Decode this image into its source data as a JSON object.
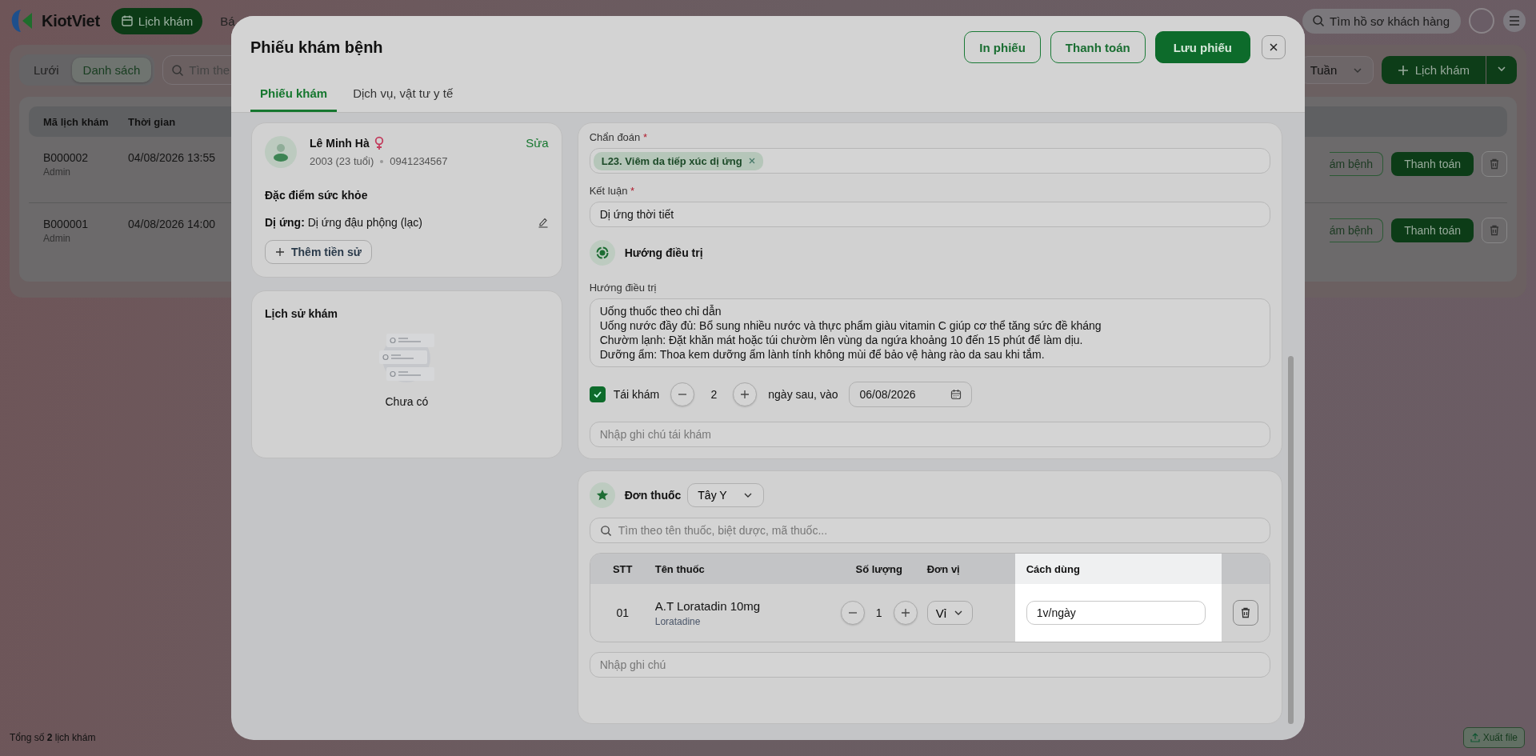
{
  "app": {
    "logo": "KiotViet",
    "nav": [
      {
        "label": "Lịch khám",
        "selected": true
      },
      {
        "label": "Bá",
        "selected": false
      }
    ],
    "search_placeholder": "Tìm hồ sơ khách hàng"
  },
  "toolbar": {
    "views": [
      {
        "label": "Lưới",
        "selected": false
      },
      {
        "label": "Danh sách",
        "selected": true
      }
    ],
    "search_placeholder": "Tìm the",
    "period": "Tuần",
    "add_button": "Lịch khám"
  },
  "table": {
    "columns": [
      "Mã lịch khám",
      "Thời gian"
    ],
    "rows": [
      {
        "code": "B000002",
        "user": "Admin",
        "time": "04/08/2026 13:55",
        "exam_button": "ám bệnh",
        "pay_button": "Thanh toán"
      },
      {
        "code": "B000001",
        "user": "Admin",
        "time": "04/08/2026 14:00",
        "exam_button": "ám bệnh",
        "pay_button": "Thanh toán"
      }
    ]
  },
  "footer": {
    "total": "Tổng số **2** lịch khám",
    "export": "Xuất file"
  },
  "modal": {
    "title": "Phiếu khám bệnh",
    "buttons": [
      {
        "label": "In phiếu",
        "kind": "outline"
      },
      {
        "label": "Thanh toán",
        "kind": "outline"
      },
      {
        "label": "Lưu phiếu",
        "kind": "primary"
      }
    ],
    "tabs": [
      {
        "label": "Phiếu khám",
        "selected": true
      },
      {
        "label": "Dịch vụ, vật tư y tế",
        "selected": false
      }
    ],
    "patient": {
      "name": "Lê Minh Hà",
      "birth": "2003 (23 tuổi)",
      "phone": "0941234567",
      "edit": "Sửa"
    },
    "health": {
      "title": "Đặc điểm sức khỏe",
      "allergy": "**Dị ứng:** Dị ứng đậu phộng (lạc)",
      "add_history": "Thêm tiền sử"
    },
    "history": {
      "title": "Lịch sử khám",
      "empty": "Chưa có"
    },
    "diagnosis": {
      "label": "Chẩn đoán",
      "mark": "*",
      "tags": [
        "L23. Viêm da tiếp xúc dị ứng"
      ]
    },
    "conclusion": {
      "label": "Kết luận",
      "mark": "*",
      "value": "Dị ứng thời tiết"
    },
    "treatment": {
      "section_title": "Hướng điều trị",
      "label": "Hướng điều trị",
      "lines": [
        "Uống thuốc theo chỉ dẫn",
        "Uống nước đầy đủ: Bổ sung nhiều nước và thực phẩm giàu vitamin C giúp cơ thể tăng sức đề kháng",
        "Chườm lạnh: Đặt khăn mát hoặc túi chườm lên vùng da ngứa khoảng 10 đến 15 phút để làm dịu.",
        "Dưỡng ẩm: Thoa kem dưỡng ẩm lành tính không mùi để bảo vệ hàng rào da sau khi tắm."
      ]
    },
    "followup": {
      "checked": true,
      "label": "Tái khám",
      "days": "2",
      "after": "ngày sau, vào",
      "date": "06/08/2026",
      "note_placeholder": "Nhập ghi chú tái khám"
    },
    "prescription": {
      "title": "Đơn thuốc",
      "type": "Tây Y",
      "search_placeholder": "Tìm theo tên thuốc, biệt dược, mã thuốc...",
      "columns": [
        {
          "label": "STT",
          "highlighted": false
        },
        {
          "label": "Tên thuốc",
          "highlighted": false
        },
        {
          "label": "Số lượng",
          "highlighted": false
        },
        {
          "label": "Đơn vị",
          "highlighted": false
        },
        {
          "label": "Cách dùng",
          "highlighted": true
        }
      ],
      "rows": [
        {
          "index": "01",
          "name": "A.T Loratadin 10mg",
          "generic": "Loratadine",
          "quantity": "1",
          "unit": "Vỉ",
          "usage": "1v/ngày"
        }
      ],
      "note_placeholder": "Nhập ghi chú"
    }
  }
}
